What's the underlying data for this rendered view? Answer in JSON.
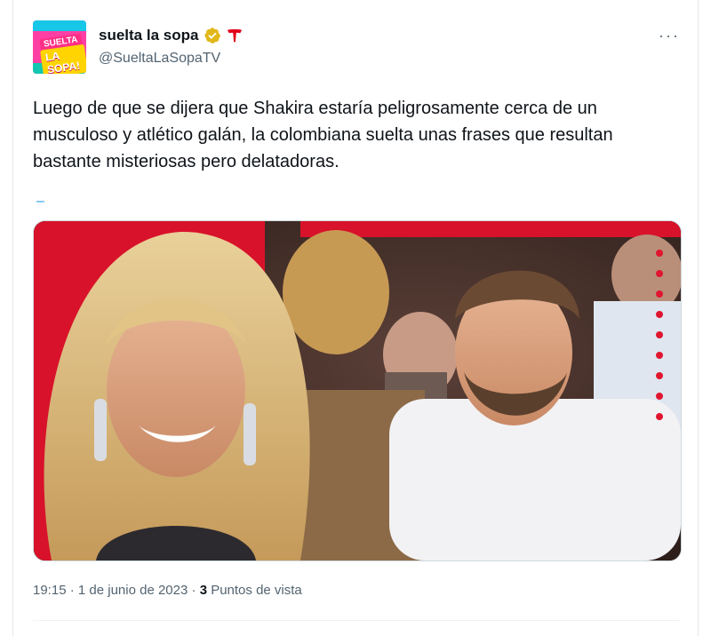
{
  "tweet": {
    "display_name": "suelta la sopa",
    "handle": "@SueltaLaSopaTV",
    "avatar_text_top": "SUELTA",
    "avatar_text_bottom": "LA SOPA!",
    "more_label": "···",
    "text": "Luego de que se dijera que Shakira estaría peligrosamente cerca de un musculoso y atlético galán, la colombiana suelta unas frases que resultan bastante misteriosas pero delatadoras.",
    "dash": "–",
    "time": "19:15",
    "separator": "·",
    "date": "1 de junio de 2023",
    "views_count": "3",
    "views_label": "Puntos de vista"
  },
  "icons": {
    "verified": "verified-badge-icon",
    "network": "telemundo-t-icon",
    "more": "more-options-icon"
  },
  "colors": {
    "verified_gold": "#e2b719",
    "network_red": "#e1001a",
    "media_red": "#d8122a",
    "link_blue": "#1d9bf0"
  }
}
